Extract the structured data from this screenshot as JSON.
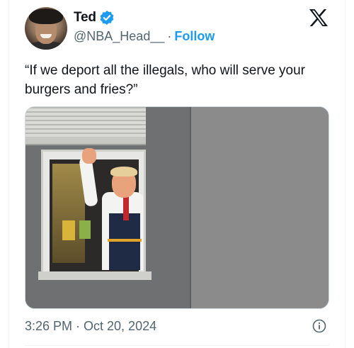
{
  "user": {
    "name": "Ted",
    "handle": "@NBA_Head__",
    "separator": "·",
    "follow_label": "Follow"
  },
  "tweet": {
    "text": "“If we deport all the illegals, who will serve your burgers and fries?”",
    "timestamp": "3:26 PM · Oct 20, 2024"
  },
  "icons": {
    "verified": "verified-badge-icon",
    "brand": "x-logo-icon",
    "info": "info-icon"
  },
  "colors": {
    "accent": "#1d9bf0",
    "text": "#0f1419",
    "secondary": "#536471"
  }
}
